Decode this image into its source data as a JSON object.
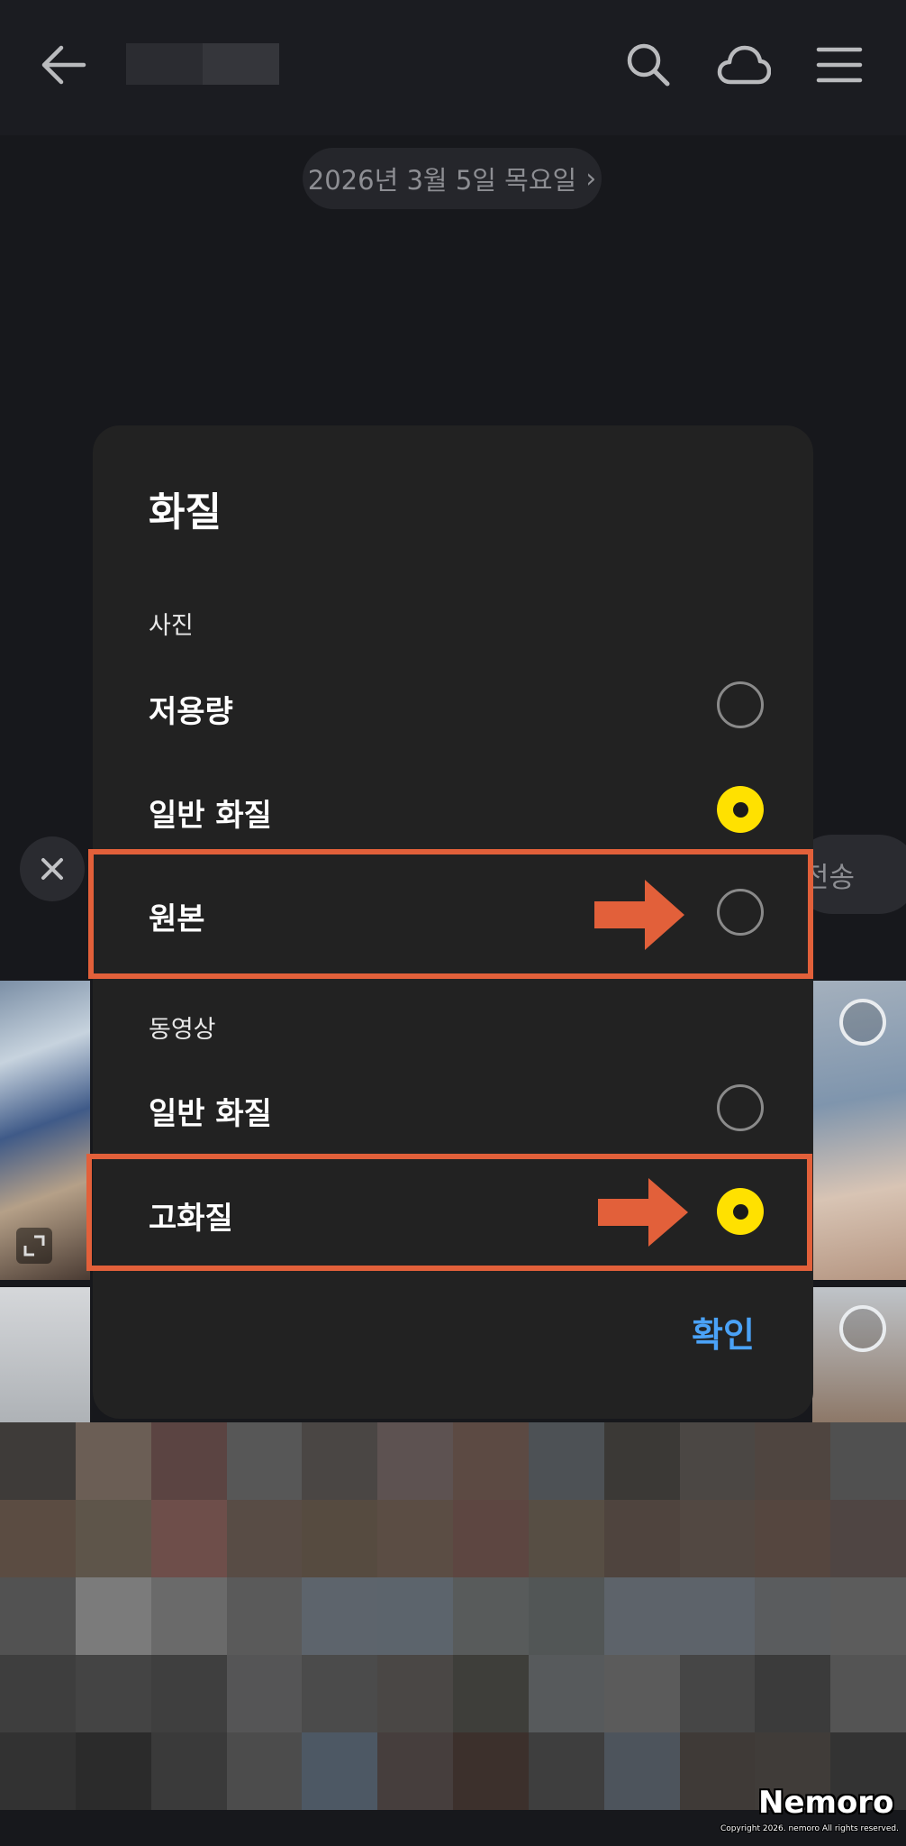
{
  "header": {
    "date_label": "2026년 3월 5일 목요일"
  },
  "background": {
    "send_label": "전송"
  },
  "dialog": {
    "title": "화질",
    "photo_section": "사진",
    "photo_options": [
      {
        "label": "저용량",
        "selected": false
      },
      {
        "label": "일반 화질",
        "selected": true
      },
      {
        "label": "원본",
        "selected": false
      }
    ],
    "video_section": "동영상",
    "video_options": [
      {
        "label": "일반 화질",
        "selected": false
      },
      {
        "label": "고화질",
        "selected": true
      }
    ],
    "confirm_label": "확인"
  },
  "colors": {
    "accent_radio": "#ffe100",
    "confirm_text": "#4aa2f7",
    "highlight": "#e2603a"
  },
  "mosaic": [
    "#3e3b39",
    "#6b5e55",
    "#5b4442",
    "#575757",
    "#4a4644",
    "#5d5251",
    "#5c4a43",
    "#4d5155",
    "#3b3936",
    "#4b4744",
    "#4f4540",
    "#505050",
    "#5b4c42",
    "#5e554a",
    "#6e4e4a",
    "#584c45",
    "#564b40",
    "#5b4d44",
    "#5d4641",
    "#574e44",
    "#4f443e",
    "#524842",
    "#55463f",
    "#4f4543",
    "#525252",
    "#7b7b7b",
    "#6a6a6a",
    "#5a5a5a",
    "#5d646c",
    "#5c646c",
    "#585b5b",
    "#525656",
    "#5d636a",
    "#5d636a",
    "#5a5c5e",
    "#5c5c5c",
    "#3e3e3e",
    "#444444",
    "#3f3f3f",
    "#555556",
    "#4b4b4b",
    "#4a4745",
    "#3e3e3a",
    "#575a5c",
    "#5b5b5b",
    "#464646",
    "#3b3b3b",
    "#545454",
    "#323232",
    "#2b2b2b",
    "#3a3a3a",
    "#4c4c4c",
    "#4d5864",
    "#463e3d",
    "#3c302c",
    "#3e3e3e",
    "#4d545c",
    "#3f3a37",
    "#403c39",
    "#333333"
  ],
  "watermark": {
    "brand": "Nemoro",
    "copyright": "Copyright 2026. nemoro All rights reserved."
  }
}
